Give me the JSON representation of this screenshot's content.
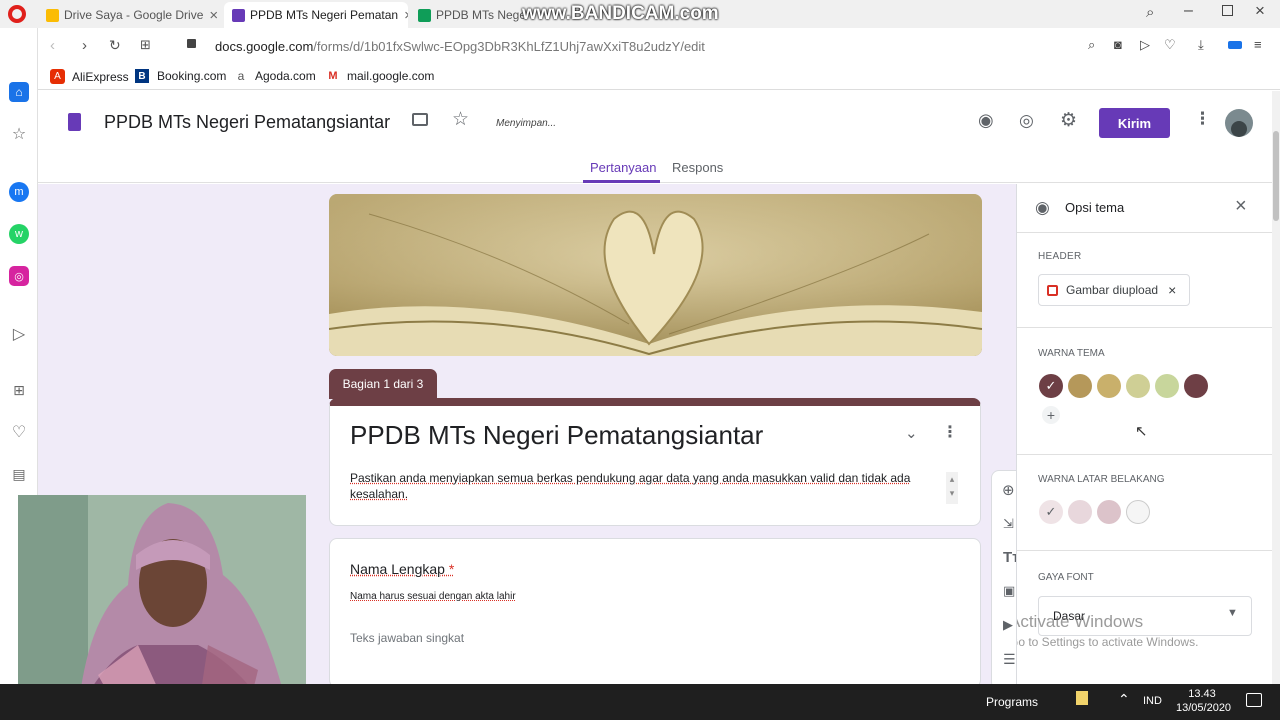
{
  "browser": {
    "tabs": [
      {
        "title": "Drive Saya - Google Drive",
        "color": "#fbbc04"
      },
      {
        "title": "PPDB MTs Negeri Pematan",
        "color": "#673ab7"
      },
      {
        "title": "PPDB MTs Negeri",
        "color": "#0f9d58"
      }
    ],
    "watermark": "www.BANDICAM.com",
    "url_host": "docs.google.com",
    "url_path": "/forms/d/1b01fxSwlwc-EOpg3DbR3KhLfZ1Uhj7awXxiT8u2udzY/edit",
    "bookmarks": [
      {
        "label": "AliExpress",
        "color": "#e62e04",
        "glyph": "A"
      },
      {
        "label": "Booking.com",
        "color": "#003580",
        "glyph": "B"
      },
      {
        "label": "Agoda.com",
        "color": "#555555",
        "glyph": "a"
      },
      {
        "label": "mail.google.com",
        "color": "#d93025",
        "glyph": "M"
      }
    ]
  },
  "form_header": {
    "title": "PPDB MTs Negeri Pematangsiantar",
    "saving_status": "Menyimpan...",
    "send_label": "Kirim",
    "tabs": {
      "questions": "Pertanyaan",
      "responses": "Respons"
    }
  },
  "canvas": {
    "section_label": "Bagian 1 dari 3",
    "form_title": "PPDB MTs Negeri Pematangsiantar",
    "description": "Pastikan anda menyiapkan semua berkas pendukung agar data yang anda masukkan valid dan tidak ada kesalahan.",
    "question": {
      "title": "Nama Lengkap",
      "required_mark": "*",
      "hint": "Nama harus sesuai dengan akta lahir",
      "placeholder": "Teks jawaban singkat"
    }
  },
  "theme_panel": {
    "title": "Opsi tema",
    "header_label": "HEADER",
    "header_chip": "Gambar diupload",
    "theme_color_label": "WARNA TEMA",
    "theme_colors": [
      "#6d3f45",
      "#b5985a",
      "#c9b06b",
      "#cfcf95",
      "#c8d69c",
      "#6e3f45"
    ],
    "bg_color_label": "WARNA LATAR BELAKANG",
    "bg_colors": [
      "#efe3e6",
      "#e8d7dc",
      "#dcc3ca",
      "#f5f5f5"
    ],
    "font_label": "GAYA FONT",
    "font_value": "Dasar"
  },
  "activate": {
    "line1": "Activate Windows",
    "line2": "Go to Settings to activate Windows."
  },
  "taskbar": {
    "programs": "Programs",
    "lang": "IND",
    "time": "13.43",
    "date": "13/05/2020"
  }
}
